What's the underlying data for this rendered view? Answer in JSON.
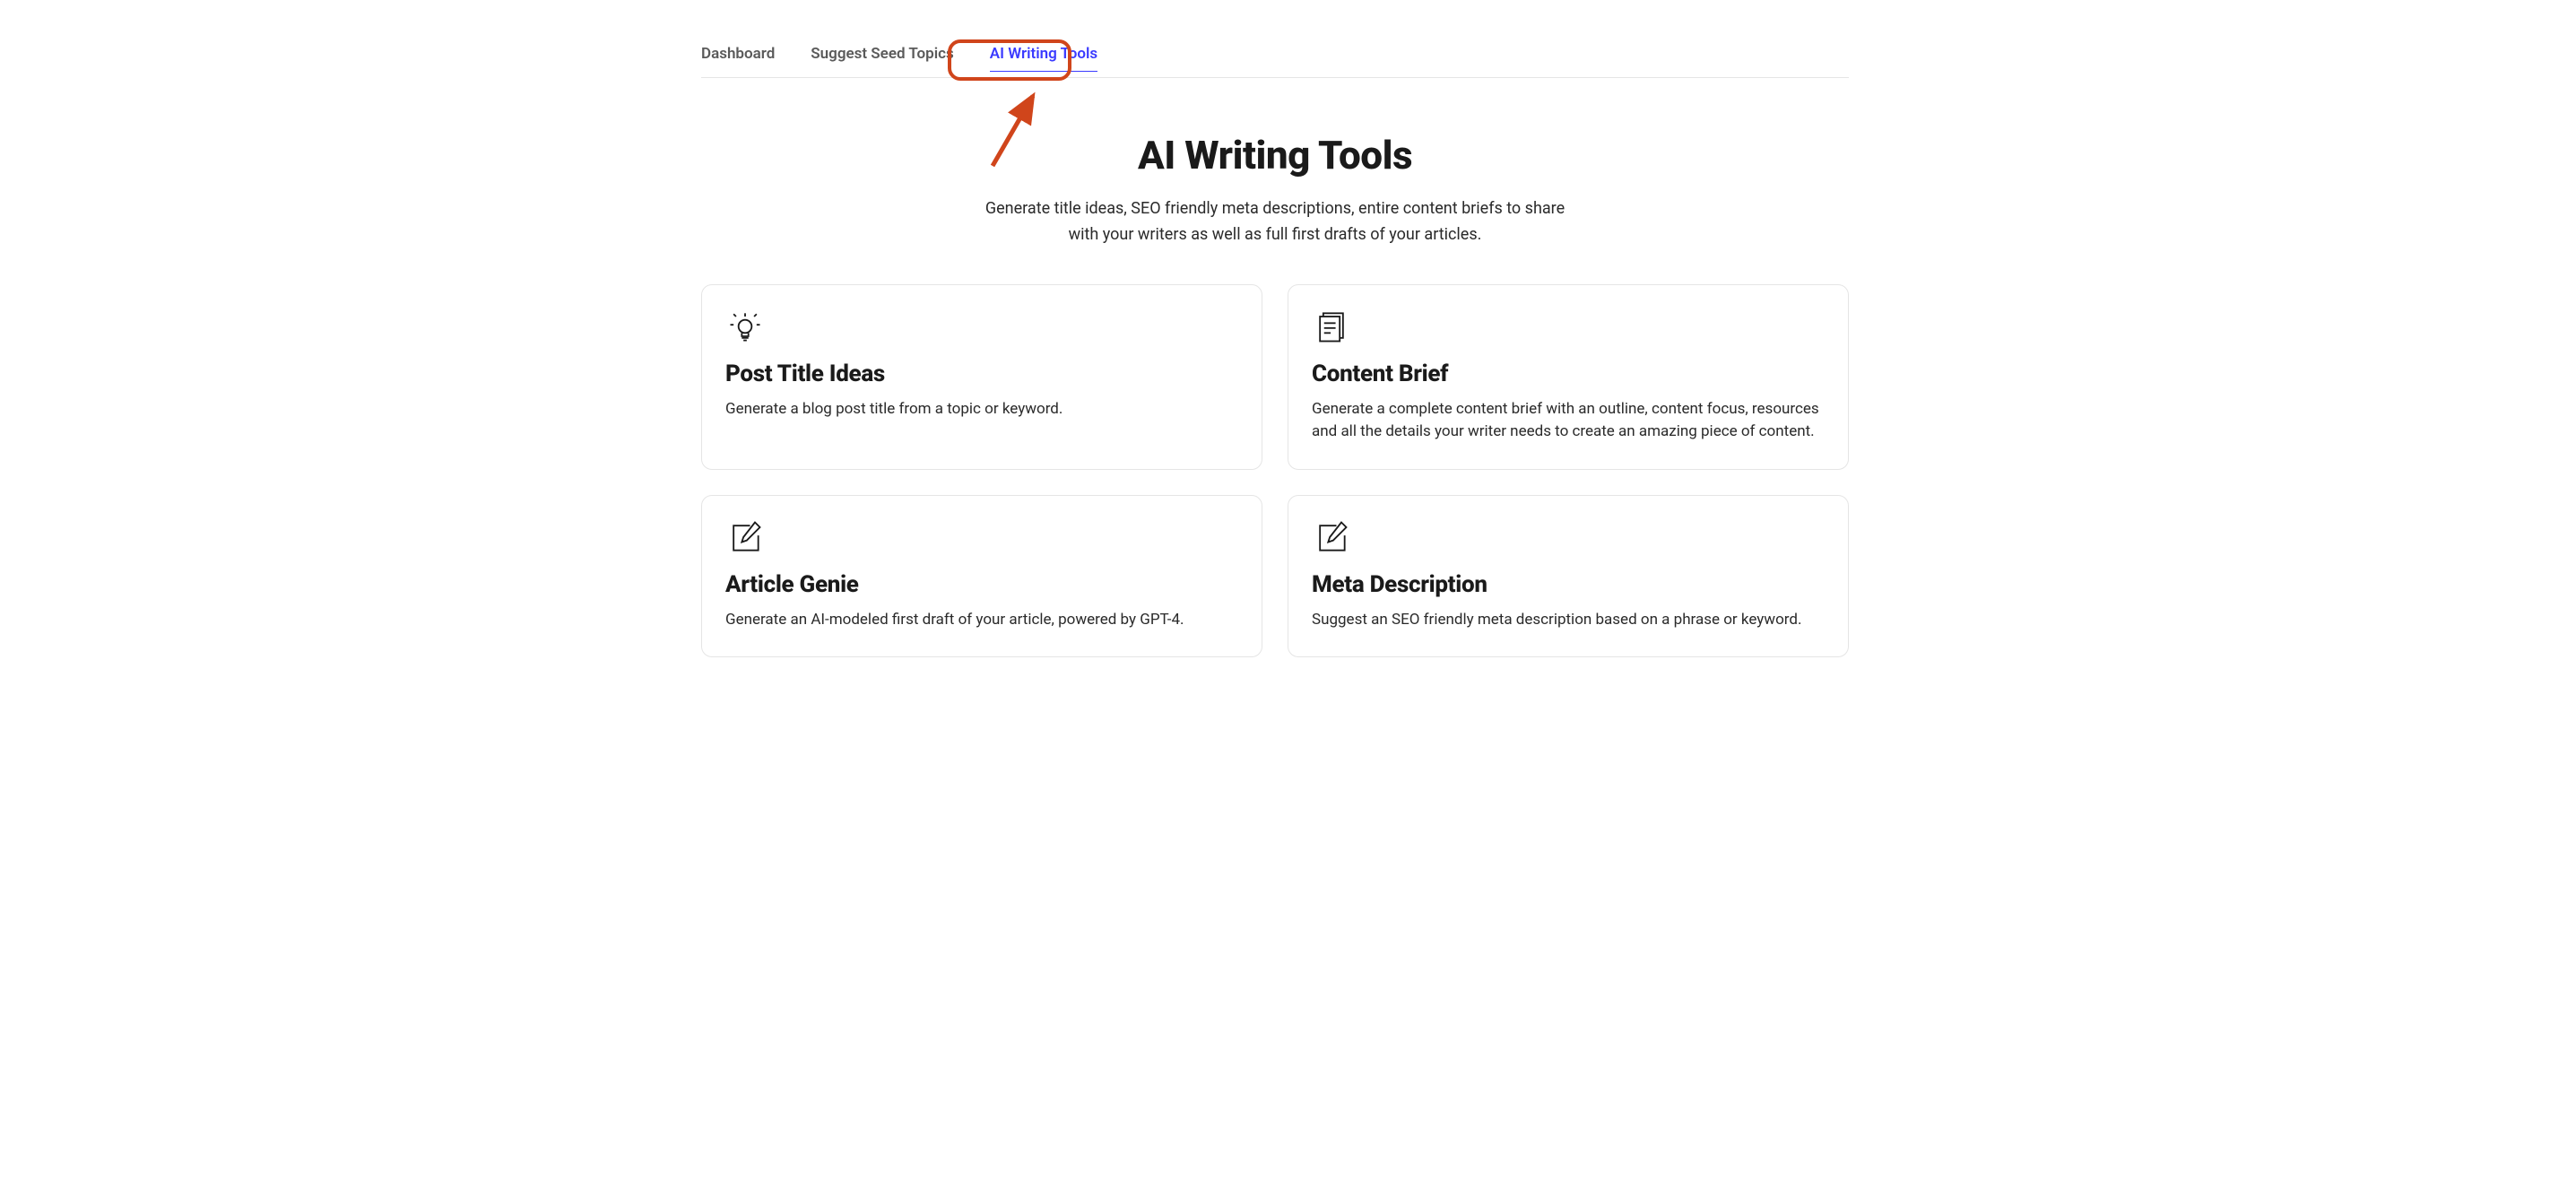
{
  "tabs": {
    "items": [
      {
        "label": "Dashboard",
        "active": false
      },
      {
        "label": "Suggest Seed Topics",
        "active": false
      },
      {
        "label": "AI Writing Tools",
        "active": true
      }
    ]
  },
  "hero": {
    "title": "AI Writing Tools",
    "subtitle": "Generate title ideas, SEO friendly meta descriptions, entire content briefs to share with your writers as well as full first drafts of your articles."
  },
  "cards": [
    {
      "icon": "lightbulb-icon",
      "title": "Post Title Ideas",
      "description": "Generate a blog post title from a topic or keyword."
    },
    {
      "icon": "document-icon",
      "title": "Content Brief",
      "description": "Generate a complete content brief with an outline, content focus, resources and all the details your writer needs to create an amazing piece of content."
    },
    {
      "icon": "pencil-square-icon",
      "title": "Article Genie",
      "description": "Generate an AI-modeled first draft of your article, powered by GPT-4."
    },
    {
      "icon": "pencil-square-icon",
      "title": "Meta Description",
      "description": "Suggest an SEO friendly meta description based on a phrase or keyword."
    }
  ],
  "annotation": {
    "highlight_color": "#d0451b",
    "arrow_color": "#d0451b"
  }
}
